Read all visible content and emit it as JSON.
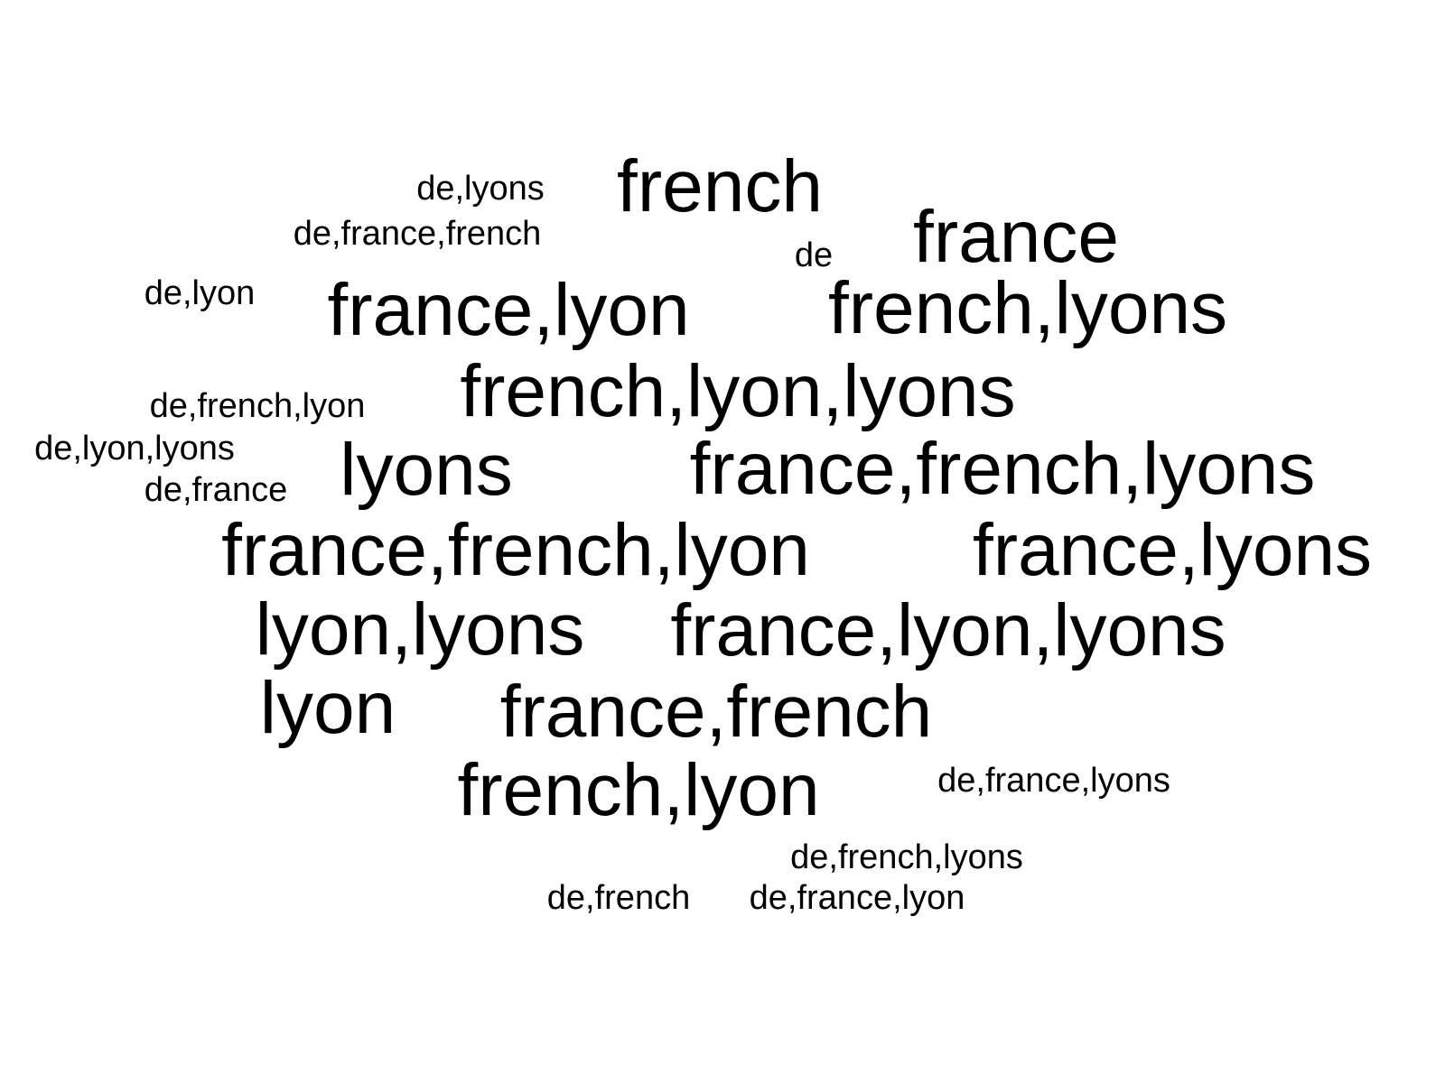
{
  "colors": {
    "background": "#ffffff",
    "text": "#000000"
  },
  "words": [
    {
      "text": "french",
      "weight": 3
    },
    {
      "text": "de,lyons",
      "weight": 1
    },
    {
      "text": "de,france,french",
      "weight": 1
    },
    {
      "text": "france",
      "weight": 3
    },
    {
      "text": "de",
      "weight": 1
    },
    {
      "text": "de,lyon",
      "weight": 1
    },
    {
      "text": "france,lyon",
      "weight": 3
    },
    {
      "text": "french,lyons",
      "weight": 3
    },
    {
      "text": "french,lyon,lyons",
      "weight": 3
    },
    {
      "text": "de,french,lyon",
      "weight": 1
    },
    {
      "text": "de,lyon,lyons",
      "weight": 1
    },
    {
      "text": "lyons",
      "weight": 3
    },
    {
      "text": "france,french,lyons",
      "weight": 3
    },
    {
      "text": "de,france",
      "weight": 1
    },
    {
      "text": "france,french,lyon",
      "weight": 3
    },
    {
      "text": "france,lyons",
      "weight": 3
    },
    {
      "text": "lyon,lyons",
      "weight": 3
    },
    {
      "text": "france,lyon,lyons",
      "weight": 3
    },
    {
      "text": "lyon",
      "weight": 3
    },
    {
      "text": "france,french",
      "weight": 3
    },
    {
      "text": "french,lyon",
      "weight": 3
    },
    {
      "text": "de,france,lyons",
      "weight": 1
    },
    {
      "text": "de,french,lyons",
      "weight": 1
    },
    {
      "text": "de,french",
      "weight": 1
    },
    {
      "text": "de,france,lyon",
      "weight": 1
    }
  ]
}
